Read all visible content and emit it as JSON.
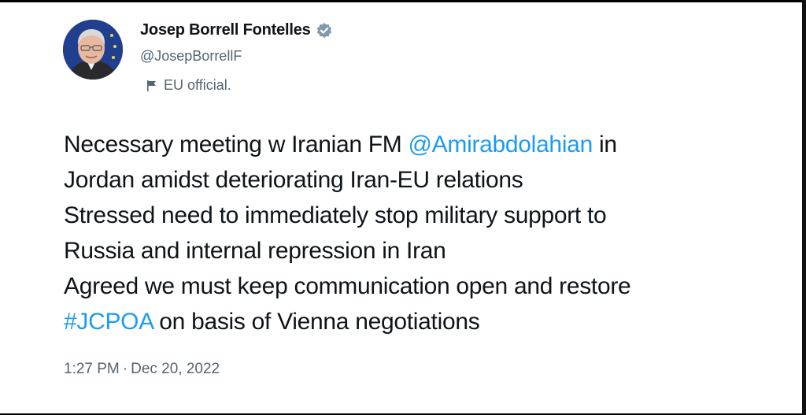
{
  "author": {
    "display_name": "Josep Borrell Fontelles",
    "handle": "@JosepBorrellF",
    "label": "EU official."
  },
  "tweet": {
    "line1_before": "Necessary meeting w Iranian FM ",
    "line1_mention": "@Amirabdolahian",
    "line1_after": " in",
    "line2": "Jordan amidst deteriorating Iran-EU relations",
    "line3": "Stressed need to immediately stop military support to",
    "line4": "Russia and internal repression in Iran",
    "line5": "Agreed we must keep communication open and restore",
    "line6_hashtag": "#JCPOA",
    "line6_after": " on basis of Vienna negotiations"
  },
  "meta": {
    "time": "1:27 PM",
    "separator": "·",
    "date": "Dec 20, 2022"
  },
  "colors": {
    "link": "#1d9bf0",
    "text": "#0f1419",
    "secondary": "#536471",
    "verified": "#829aab"
  },
  "icons": {
    "verified": "verified-badge-icon",
    "label": "flag-icon"
  }
}
